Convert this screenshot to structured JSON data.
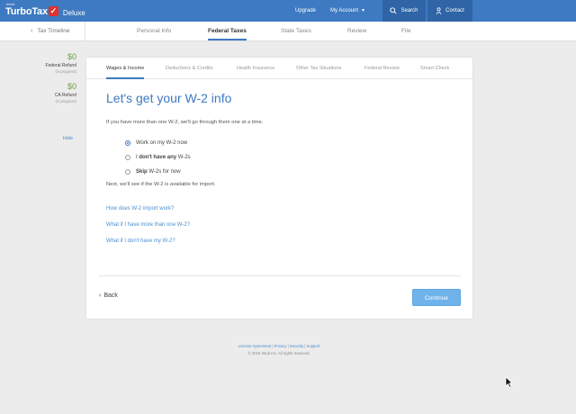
{
  "brand": {
    "intuit": "intuit",
    "name": "TurboTax",
    "edition": "Deluxe"
  },
  "topnav": {
    "upgrade": "Upgrade",
    "my_account": "My Account",
    "search": "Search",
    "contact": "Contact"
  },
  "subnav": {
    "timeline": "Tax Timeline",
    "steps": [
      "Personal Info",
      "Federal Taxes",
      "State Taxes",
      "Review",
      "File"
    ],
    "active_step": "Federal Taxes"
  },
  "refunds": [
    {
      "amount": "$0",
      "label": "Federal Refund",
      "status": "(in progress)"
    },
    {
      "amount": "$0",
      "label": "CA Refund",
      "status": "(in progress)"
    }
  ],
  "hide_label": "Hide",
  "card": {
    "tabs": [
      "Wages & Income",
      "Deductions & Credits",
      "Health Insurance",
      "Other Tax Situations",
      "Federal Review",
      "Smart Check"
    ],
    "active_tab": "Wages & Income",
    "heading": "Let's get your W-2 info",
    "intro": "If you have more than one W-2, we'll go through them one at a time.",
    "options": [
      {
        "pre": "",
        "bold": "",
        "post": "Work on my W-2 now",
        "selected": true
      },
      {
        "pre": "I ",
        "bold": "don't have any",
        "post": " W-2s",
        "selected": false
      },
      {
        "pre": "",
        "bold": "Skip",
        "post": " W-2s for now",
        "selected": false
      }
    ],
    "next_note": "Next, we'll see if the W-2 is available for import.",
    "links": [
      "How does W-2 import work?",
      "What if I have more than one W-2?",
      "What if I don't have my W-2?"
    ],
    "back_label": "Back",
    "continue_label": "Continue"
  },
  "footer": {
    "links": [
      "License Agreement",
      "Privacy",
      "Security",
      "Support"
    ],
    "copyright": "© 2016 Intuit Inc. All rights reserved."
  },
  "colors": {
    "brand_blue": "#3d7ac1",
    "refund_green": "#6aa13f",
    "link_blue": "#4a8fd1",
    "continue_blue": "#6fb3ea"
  }
}
